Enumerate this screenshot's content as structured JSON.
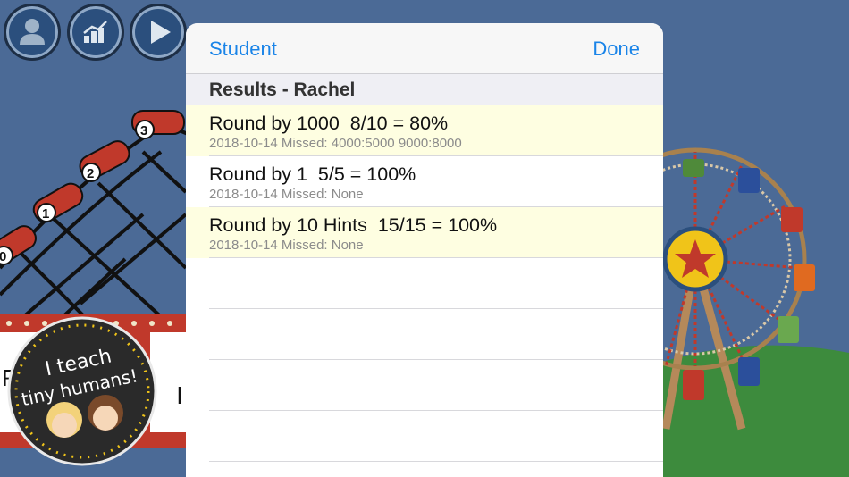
{
  "toolbar": {
    "student_icon": "person-icon",
    "stats_icon": "bar-chart-icon",
    "play_icon": "play-icon"
  },
  "scene": {
    "badge_text_line1": "I teach",
    "badge_text_line2": "tiny humans!",
    "car_numbers": [
      "3",
      "2",
      "1",
      "0"
    ],
    "sign_fragment": "Ro",
    "sign_fragment2": "l"
  },
  "sheet": {
    "nav": {
      "left_label": "Student",
      "right_label": "Done"
    },
    "section_title": "Results - Rachel",
    "results": [
      {
        "title": "Round by 1000  8/10 = 80%",
        "detail": "2018-10-14 Missed: 4000:5000 9000:8000",
        "highlight": true
      },
      {
        "title": "Round by 1  5/5 = 100%",
        "detail": "2018-10-14 Missed: None",
        "highlight": false
      },
      {
        "title": "Round by 10 Hints  15/15 = 100%",
        "detail": "2018-10-14 Missed: None",
        "highlight": true
      }
    ]
  },
  "colors": {
    "sky": "#4b6a96",
    "accent_blue": "#1a84e8",
    "row_highlight": "#fefee1",
    "grass": "#3d8b3d"
  }
}
